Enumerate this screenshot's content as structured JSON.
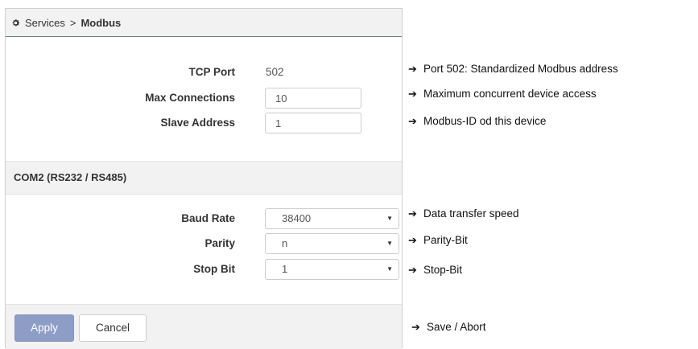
{
  "breadcrumb": {
    "parent": "Services",
    "separator": ">",
    "current": "Modbus",
    "icon": "gear-icon"
  },
  "modbus": {
    "tcp_port": {
      "label": "TCP Port",
      "value": "502"
    },
    "max_connections": {
      "label": "Max Connections",
      "value": "10"
    },
    "slave_address": {
      "label": "Slave Address",
      "value": "1"
    }
  },
  "com2": {
    "title": "COM2 (RS232 / RS485)",
    "baud_rate": {
      "label": "Baud Rate",
      "value": "38400"
    },
    "parity": {
      "label": "Parity",
      "value": "n"
    },
    "stop_bit": {
      "label": "Stop Bit",
      "value": "1"
    }
  },
  "buttons": {
    "apply": "Apply",
    "cancel": "Cancel"
  },
  "annotations": {
    "arrow": "➔",
    "tcp_port": "Port 502: Standardized Modbus address",
    "max_connections": "Maximum concurrent device access",
    "slave_address": "Modbus-ID od this device",
    "baud_rate": "Data transfer speed",
    "parity": "Parity-Bit",
    "stop_bit": "Stop-Bit",
    "buttons": "Save / Abort"
  },
  "colors": {
    "apply_button": "#8d9dc6",
    "header_border": "#6b7a8c",
    "panel_bg": "#f2f2f2"
  }
}
